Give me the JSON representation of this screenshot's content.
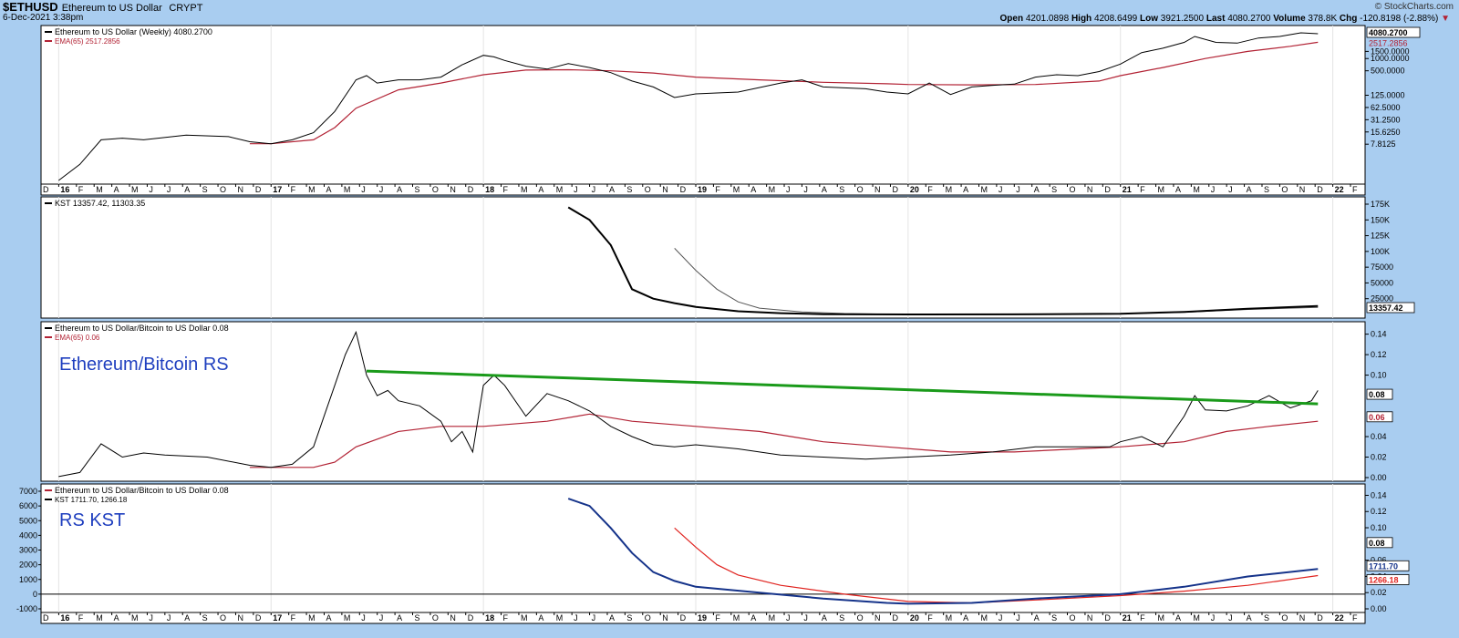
{
  "header": {
    "symbol": "$ETHUSD",
    "name": "Ethereum to US Dollar",
    "exchange": "CRYPT",
    "date": "6-Dec-2021 3:38pm",
    "brand": "© StockCharts.com",
    "open_label": "Open",
    "open": "4201.0898",
    "high_label": "High",
    "high": "4208.6499",
    "low_label": "Low",
    "low": "3921.2500",
    "last_label": "Last",
    "last": "4080.2700",
    "volume_label": "Volume",
    "volume": "378.8K",
    "chg_label": "Chg",
    "chg": "-120.8198 (-2.88%)"
  },
  "colors": {
    "background": "#a9cdf0",
    "panel": "#ffffff",
    "price": "#000000",
    "ema": "#b22234",
    "trend": "#1a9a1a",
    "kst_rs": "#15338a",
    "annotation": "#1f3fbf"
  },
  "chart_data": [
    {
      "type": "line",
      "title": "Ethereum to US Dollar (Weekly) 4080.2700",
      "scale": "log",
      "yticks": [
        "4080.2700",
        "2517.2856",
        "1500.0000",
        "1000.0000",
        "500.0000",
        "125.0000",
        "62.5000",
        "31.2500",
        "15.6250",
        "7.8125"
      ],
      "series": [
        {
          "name": "Ethereum to US Dollar (Weekly) 4080.2700",
          "x": [
            2016.0,
            2016.1,
            2016.2,
            2016.3,
            2016.4,
            2016.6,
            2016.8,
            2016.9,
            2017.0,
            2017.1,
            2017.2,
            2017.3,
            2017.4,
            2017.45,
            2017.5,
            2017.6,
            2017.7,
            2017.8,
            2017.9,
            2018.0,
            2018.05,
            2018.1,
            2018.2,
            2018.3,
            2018.4,
            2018.5,
            2018.6,
            2018.7,
            2018.8,
            2018.9,
            2019.0,
            2019.2,
            2019.4,
            2019.5,
            2019.6,
            2019.8,
            2019.9,
            2020.0,
            2020.1,
            2020.2,
            2020.3,
            2020.4,
            2020.5,
            2020.6,
            2020.7,
            2020.8,
            2020.9,
            2021.0,
            2021.1,
            2021.2,
            2021.3,
            2021.35,
            2021.45,
            2021.55,
            2021.65,
            2021.75,
            2021.85,
            2021.93
          ],
          "y": [
            1,
            2.5,
            10,
            11,
            10,
            13,
            12,
            9,
            8,
            10,
            15,
            50,
            300,
            380,
            250,
            300,
            300,
            350,
            700,
            1200,
            1100,
            900,
            650,
            550,
            750,
            600,
            450,
            280,
            200,
            110,
            135,
            150,
            250,
            300,
            200,
            180,
            150,
            135,
            250,
            130,
            200,
            220,
            235,
            350,
            400,
            380,
            480,
            730,
            1400,
            1800,
            2500,
            3500,
            2500,
            2400,
            3200,
            3500,
            4300,
            4080
          ]
        },
        {
          "name": "EMA(65) 2517.2856",
          "x": [
            2016.9,
            2017.0,
            2017.2,
            2017.3,
            2017.4,
            2017.6,
            2017.8,
            2018.0,
            2018.2,
            2018.4,
            2018.6,
            2018.8,
            2019.0,
            2019.3,
            2019.6,
            2019.9,
            2020.0,
            2020.3,
            2020.6,
            2020.9,
            2021.0,
            2021.2,
            2021.4,
            2021.6,
            2021.8,
            2021.93
          ],
          "y": [
            8,
            8,
            10,
            20,
            60,
            170,
            250,
            400,
            520,
            530,
            500,
            440,
            350,
            300,
            260,
            240,
            230,
            225,
            230,
            280,
            380,
            600,
            1000,
            1500,
            2000,
            2517
          ]
        }
      ]
    },
    {
      "type": "line",
      "title": "KST 13357.42, 11303.35",
      "yticks": [
        "175K",
        "150K",
        "125K",
        "100K",
        "75000",
        "50000",
        "25000"
      ],
      "last_label": "13357.42",
      "series": [
        {
          "name": "KST 13357.42",
          "x": [
            2018.4,
            2018.5,
            2018.6,
            2018.7,
            2018.8,
            2018.9,
            2019.0,
            2019.2,
            2019.4,
            2019.6,
            2019.8,
            2020.0,
            2020.5,
            2021.0,
            2021.3,
            2021.6,
            2021.93
          ],
          "y": [
            170000,
            150000,
            110000,
            40000,
            25000,
            18000,
            12000,
            5000,
            2000,
            500,
            100,
            0,
            200,
            1000,
            4000,
            9000,
            13357.42
          ]
        },
        {
          "name": "11303.35",
          "x": [
            2018.9,
            2019.0,
            2019.1,
            2019.2,
            2019.3,
            2019.5,
            2019.7,
            2020.0,
            2020.5,
            2021.0,
            2021.3,
            2021.6,
            2021.93
          ],
          "y": [
            105000,
            70000,
            40000,
            20000,
            10000,
            4000,
            1500,
            0,
            200,
            1000,
            3500,
            8000,
            11303.35
          ]
        }
      ]
    },
    {
      "type": "line",
      "title": "Ethereum to US Dollar/Bitcoin to US Dollar 0.08",
      "annotation": "Ethereum/Bitcoin RS",
      "yticks": [
        "0.14",
        "0.12",
        "0.10",
        "0.08",
        "0.06",
        "0.04",
        "0.02",
        "0.00"
      ],
      "last_label": "0.08",
      "ema_label": "0.06",
      "series": [
        {
          "name": "Ethereum to US Dollar/Bitcoin to US Dollar 0.08",
          "x": [
            2016.0,
            2016.1,
            2016.2,
            2016.3,
            2016.4,
            2016.5,
            2016.7,
            2016.9,
            2017.0,
            2017.1,
            2017.2,
            2017.25,
            2017.3,
            2017.35,
            2017.4,
            2017.45,
            2017.5,
            2017.55,
            2017.6,
            2017.7,
            2017.8,
            2017.85,
            2017.9,
            2017.95,
            2018.0,
            2018.05,
            2018.1,
            2018.2,
            2018.3,
            2018.4,
            2018.5,
            2018.6,
            2018.7,
            2018.8,
            2018.9,
            2019.0,
            2019.2,
            2019.4,
            2019.6,
            2019.8,
            2020.0,
            2020.2,
            2020.4,
            2020.6,
            2020.8,
            2020.95,
            2021.0,
            2021.1,
            2021.2,
            2021.3,
            2021.35,
            2021.4,
            2021.5,
            2021.6,
            2021.7,
            2021.8,
            2021.9,
            2021.93
          ],
          "y": [
            0.001,
            0.005,
            0.033,
            0.02,
            0.024,
            0.022,
            0.02,
            0.012,
            0.01,
            0.013,
            0.03,
            0.06,
            0.09,
            0.12,
            0.142,
            0.1,
            0.08,
            0.085,
            0.075,
            0.07,
            0.055,
            0.035,
            0.045,
            0.025,
            0.09,
            0.1,
            0.09,
            0.06,
            0.082,
            0.075,
            0.065,
            0.05,
            0.04,
            0.032,
            0.03,
            0.032,
            0.028,
            0.022,
            0.02,
            0.018,
            0.02,
            0.022,
            0.025,
            0.03,
            0.03,
            0.03,
            0.035,
            0.04,
            0.03,
            0.06,
            0.08,
            0.066,
            0.065,
            0.07,
            0.08,
            0.068,
            0.075,
            0.085
          ]
        },
        {
          "name": "EMA(65) 0.06",
          "x": [
            2016.9,
            2017.2,
            2017.3,
            2017.4,
            2017.6,
            2017.8,
            2018.0,
            2018.3,
            2018.5,
            2018.7,
            2019.0,
            2019.3,
            2019.6,
            2019.9,
            2020.2,
            2020.5,
            2020.8,
            2021.0,
            2021.3,
            2021.5,
            2021.7,
            2021.93
          ],
          "y": [
            0.01,
            0.01,
            0.015,
            0.03,
            0.045,
            0.05,
            0.05,
            0.055,
            0.062,
            0.055,
            0.05,
            0.045,
            0.035,
            0.03,
            0.025,
            0.025,
            0.028,
            0.03,
            0.035,
            0.045,
            0.05,
            0.055
          ]
        },
        {
          "name": "Trendline",
          "x": [
            2017.45,
            2021.93
          ],
          "y": [
            0.104,
            0.072
          ]
        }
      ]
    },
    {
      "type": "line",
      "title": "Ethereum to US Dollar/Bitcoin to US Dollar 0.08",
      "subtitle": "KST 1711.70, 1266.18",
      "annotation": "RS KST",
      "left_yticks": [
        "7000",
        "6000",
        "5000",
        "4000",
        "3000",
        "2000",
        "1000",
        "0",
        "-1000"
      ],
      "right_yticks": [
        "0.14",
        "0.12",
        "0.10",
        "0.08",
        "0.06",
        "0.04",
        "0.02",
        "0.00"
      ],
      "right_labels": [
        "0.08",
        "1711.70",
        "1266.18"
      ],
      "series": [
        {
          "name": "KST 1711.70",
          "x": [
            2018.4,
            2018.5,
            2018.6,
            2018.7,
            2018.8,
            2018.9,
            2019.0,
            2019.3,
            2019.6,
            2019.9,
            2020.0,
            2020.3,
            2020.6,
            2021.0,
            2021.3,
            2021.6,
            2021.93
          ],
          "y": [
            6500,
            6000,
            4500,
            2800,
            1500,
            900,
            500,
            100,
            -300,
            -600,
            -650,
            -600,
            -300,
            0,
            500,
            1200,
            1711.7
          ]
        },
        {
          "name": "1266.18",
          "x": [
            2018.9,
            2019.0,
            2019.1,
            2019.2,
            2019.4,
            2019.7,
            2020.0,
            2020.3,
            2020.6,
            2021.0,
            2021.3,
            2021.6,
            2021.93
          ],
          "y": [
            4500,
            3200,
            2000,
            1300,
            600,
            0,
            -500,
            -600,
            -400,
            -100,
            200,
            600,
            1266.18
          ]
        }
      ]
    }
  ],
  "x_axis": {
    "labels": [
      "D",
      "16",
      "F",
      "M",
      "A",
      "M",
      "J",
      "J",
      "A",
      "S",
      "O",
      "N",
      "D",
      "17",
      "F",
      "M",
      "A",
      "M",
      "J",
      "J",
      "A",
      "S",
      "O",
      "N",
      "D",
      "18",
      "F",
      "M",
      "A",
      "M",
      "J",
      "J",
      "A",
      "S",
      "O",
      "N",
      "D",
      "19",
      "F",
      "M",
      "A",
      "M",
      "J",
      "J",
      "A",
      "S",
      "O",
      "N",
      "D",
      "20",
      "F",
      "M",
      "A",
      "M",
      "J",
      "J",
      "A",
      "S",
      "O",
      "N",
      "D",
      "21",
      "F",
      "M",
      "A",
      "M",
      "J",
      "J",
      "A",
      "S",
      "O",
      "N",
      "D",
      "22",
      "F"
    ],
    "start": 2015.917,
    "step": 0.08333
  }
}
